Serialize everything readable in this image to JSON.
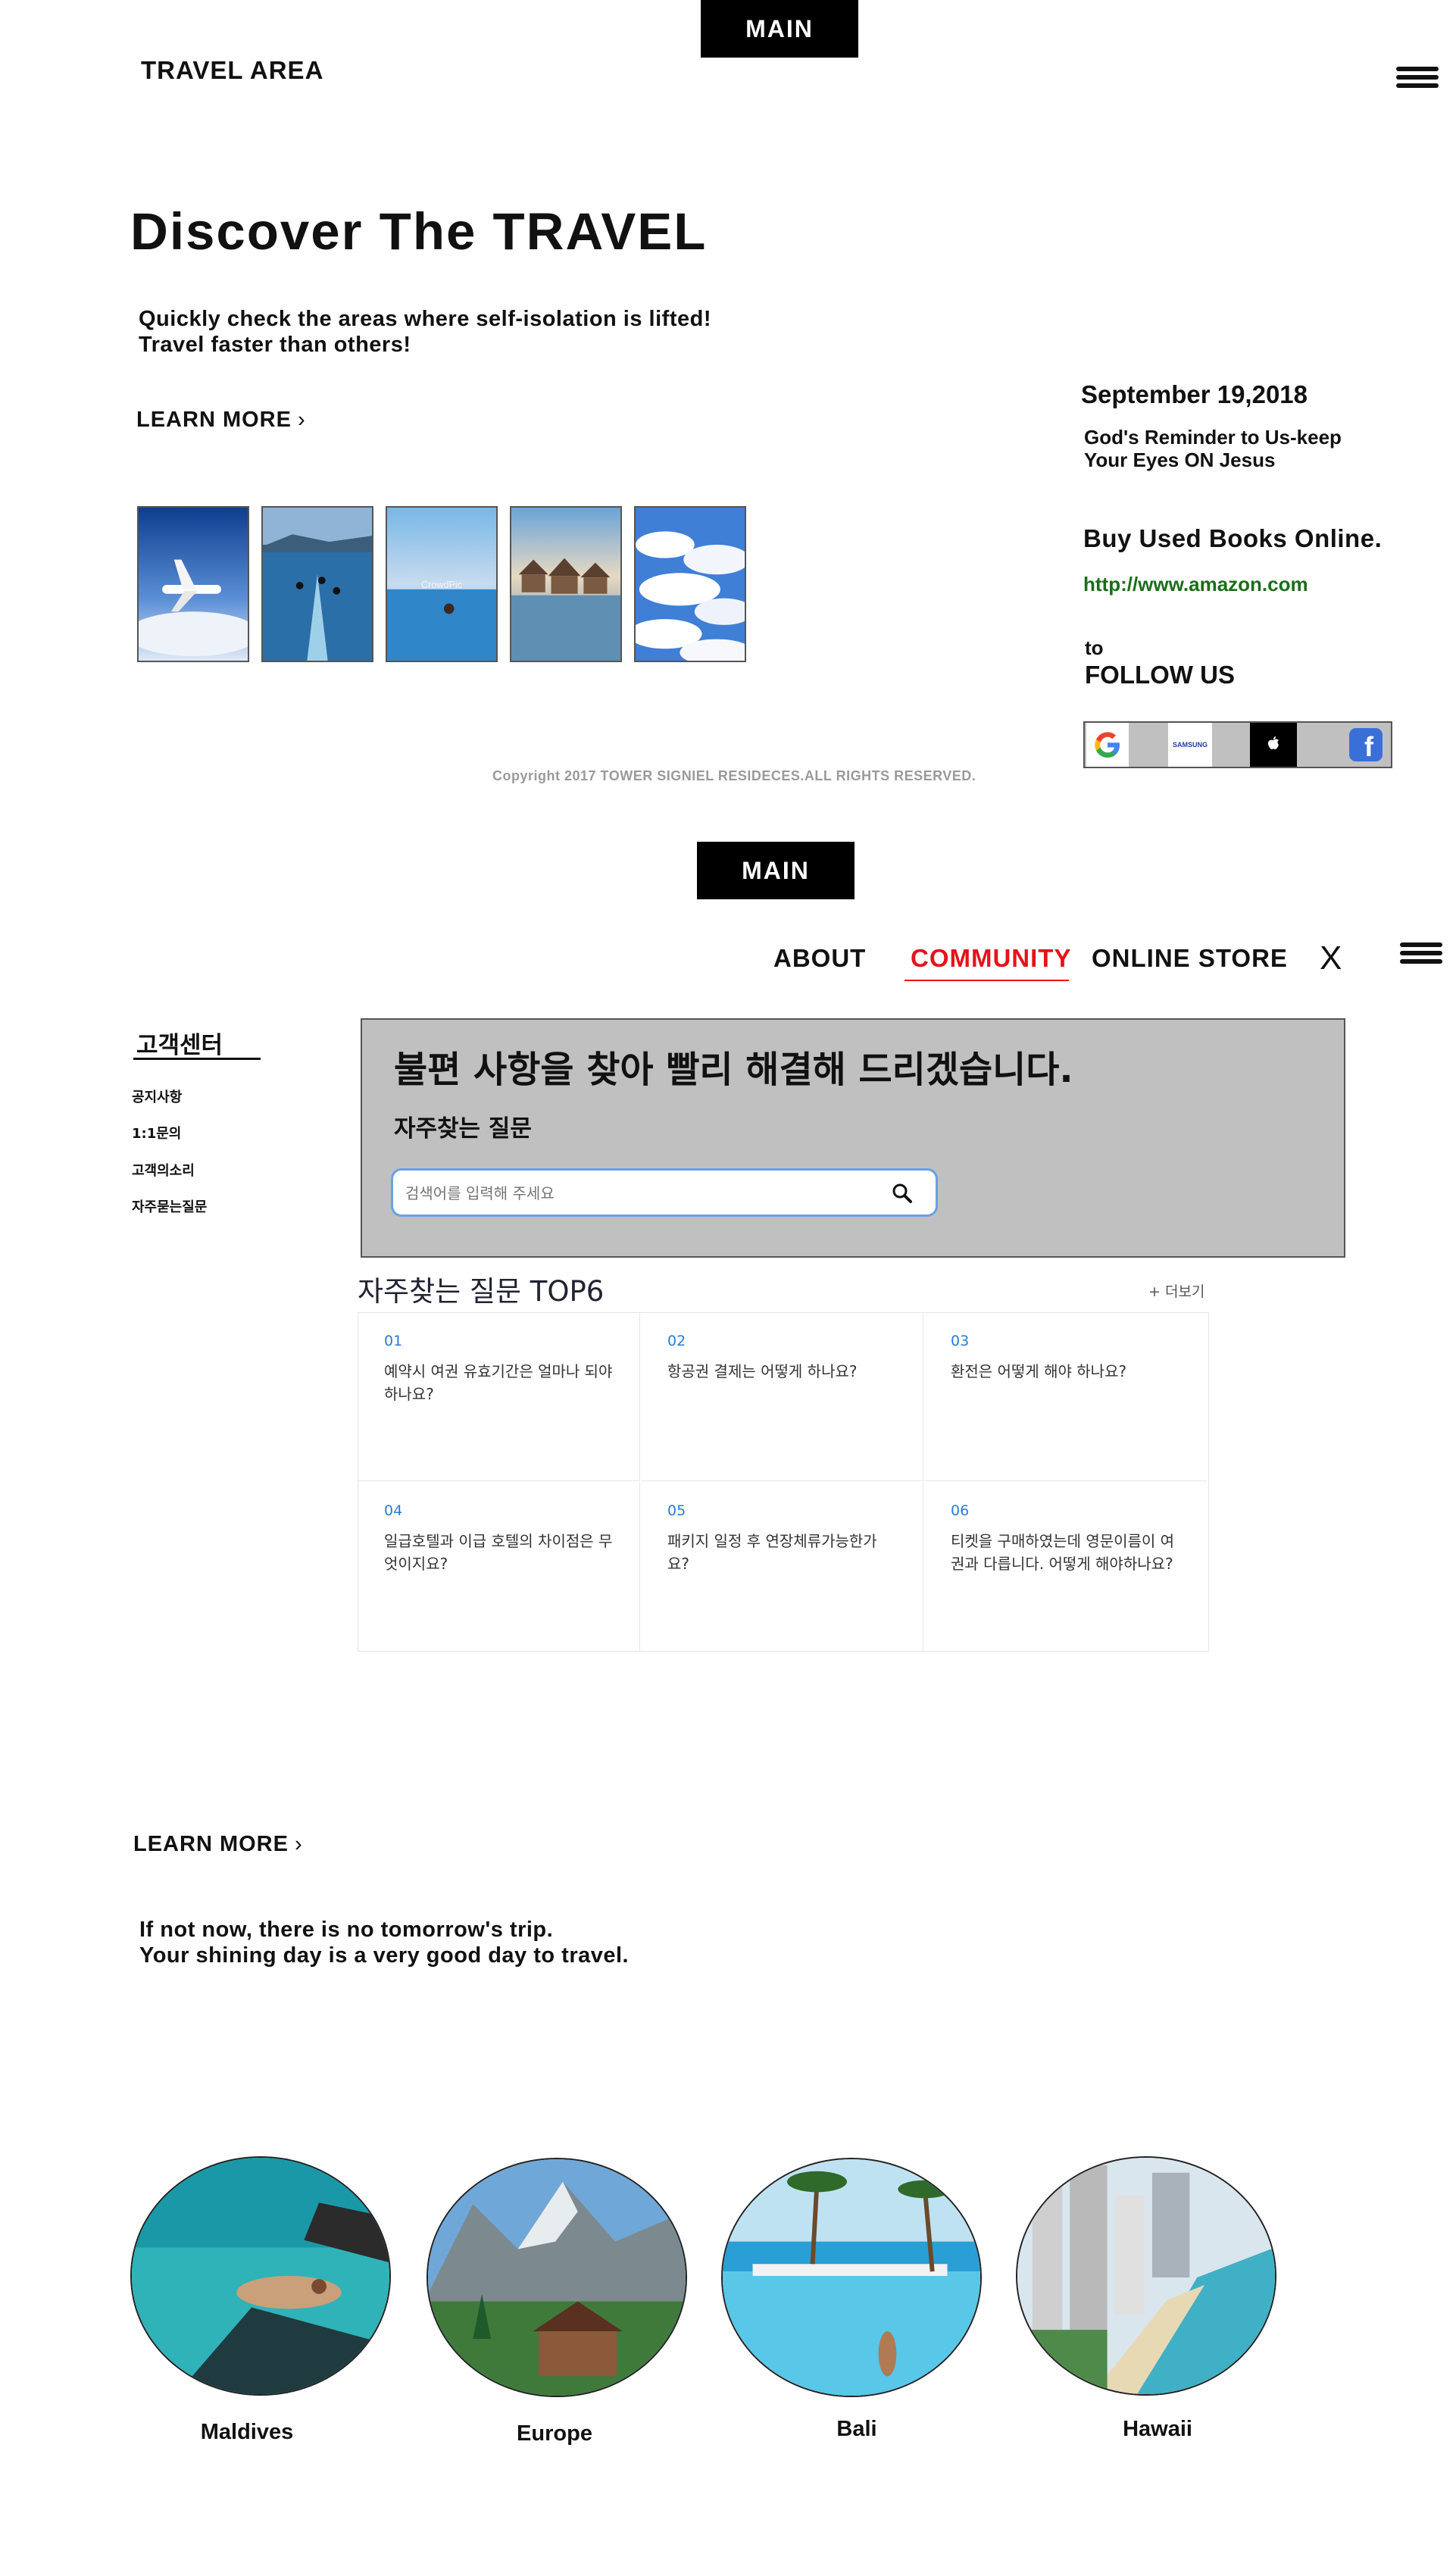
{
  "header": {
    "main_tab": "MAIN",
    "brand": "TRAVEL AREA",
    "menu_icon": "hamburger-icon"
  },
  "hero": {
    "title": "Discover The TRAVEL",
    "subtitle_line1": "Quickly check the areas where self-isolation is lifted!",
    "subtitle_line2": "Travel faster than others!",
    "learn_more": "LEARN MORE",
    "chevron": "›",
    "photos": [
      {
        "alt": "airplane"
      },
      {
        "alt": "divers"
      },
      {
        "alt": "infinity pool",
        "watermark": "CrowdPic"
      },
      {
        "alt": "water bungalows"
      },
      {
        "alt": "clouds"
      }
    ]
  },
  "aside": {
    "date": "September 19,2018",
    "note_line1": "God's Reminder to Us-keep",
    "note_line2": "Your Eyes ON Jesus",
    "books_title": "Buy Used Books Online.",
    "books_link": "http://www.amazon.com",
    "follow_small": "to",
    "follow_title": "FOLLOW US",
    "samsung_label": "SAMSUNG",
    "apple_glyph": "",
    "facebook_glyph": "f",
    "social": [
      "google-icon",
      "samsung-icon",
      "apple-icon",
      "facebook-icon"
    ]
  },
  "copyright": "Copyright 2017 TOWER SIGNIEL RESIDECES.ALL RIGHTS RESERVED.",
  "second": {
    "main_tab": "MAIN",
    "nav": {
      "about": "ABOUT",
      "community": "COMMUNITY",
      "store": "ONLINE STORE",
      "close": "X"
    },
    "colors": {
      "active": "#e4131b",
      "panel": "#c0c0c0",
      "link": "#1a6e1a",
      "faq_num": "#2a7bd6"
    }
  },
  "support": {
    "sidebar_title": "고객센터",
    "sidebar_items": [
      "공지사항",
      "1:1문의",
      "고객의소리",
      "자주묻는질문"
    ],
    "banner_title": "불편 사항을 찾아 빨리 해결해 드리겠습니다.",
    "banner_sub": "자주찾는 질문",
    "search_placeholder": "검색어를 입력해 주세요",
    "faq_title": "자주찾는 질문 TOP6",
    "more": "+ 더보기",
    "faqs": [
      {
        "num": "01",
        "q": "예약시 여권 유효기간은 얼마나 되야 하나요?"
      },
      {
        "num": "02",
        "q": "항공권 결제는 어떻게 하나요?"
      },
      {
        "num": "03",
        "q": "환전은 어떻게 해야 하나요?"
      },
      {
        "num": "04",
        "q": "일급호텔과 이급 호텔의 차이점은 무엇이지요?"
      },
      {
        "num": "05",
        "q": "패키지 일정 후 연장체류가능한가요?"
      },
      {
        "num": "06",
        "q": "티켓을 구매하였는데 영문이름이 여권과 다릅니다. 어떻게 해야하나요?"
      }
    ]
  },
  "bottom": {
    "learn_more": "LEARN MORE",
    "chevron": "›",
    "tagline_line1": "If not now, there is no tomorrow's trip.",
    "tagline_line2": "Your shining day is a very good day to travel.",
    "destinations": [
      "Maldives",
      "Europe",
      "Bali",
      "Hawaii"
    ]
  }
}
